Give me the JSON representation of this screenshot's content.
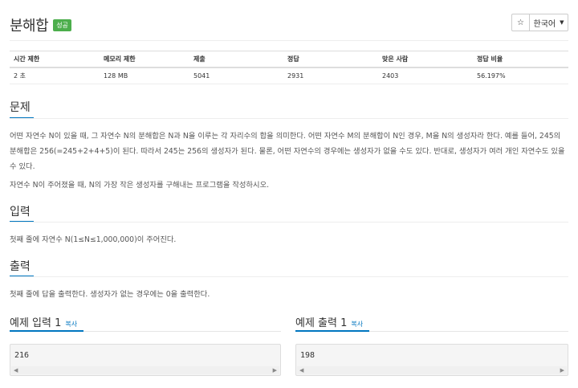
{
  "problem": {
    "title": "분해합",
    "badge": "성공"
  },
  "actions": {
    "star_icon": "star-icon",
    "language": "한국어"
  },
  "info_table": {
    "headers": [
      "시간 제한",
      "메모리 제한",
      "제출",
      "정답",
      "맞은 사람",
      "정답 비율"
    ],
    "values": [
      "2 초",
      "128 MB",
      "5041",
      "2931",
      "2403",
      "56.197%"
    ]
  },
  "sections": {
    "problem_heading": "문제",
    "problem_text_1": "어떤 자연수 N이 있을 때, 그 자연수 N의 분해합은 N과 N을 이루는 각 자리수의 합을 의미한다. 어떤 자연수 M의 분해합이 N인 경우, M을 N의 생성자라 한다. 예를 들어, 245의 분해합은 256(=245+2+4+5)이 된다. 따라서 245는 256의 생성자가 된다. 물론, 어떤 자연수의 경우에는 생성자가 없을 수도 있다. 반대로, 생성자가 여러 개인 자연수도 있을 수 있다.",
    "problem_text_2": "자연수 N이 주어졌을 때, N의 가장 작은 생성자를 구해내는 프로그램을 작성하시오.",
    "input_heading": "입력",
    "input_text": "첫째 줄에 자연수 N(1≤N≤1,000,000)이 주어진다.",
    "output_heading": "출력",
    "output_text": "첫째 줄에 답을 출력한다. 생성자가 없는 경우에는 0을 출력한다."
  },
  "examples": {
    "input_title": "예제 입력 1",
    "output_title": "예제 출력 1",
    "copy_label": "복사",
    "input_value": "216",
    "output_value": "198"
  },
  "colors": {
    "accent": "#0076c0",
    "success": "#4cae4c"
  }
}
